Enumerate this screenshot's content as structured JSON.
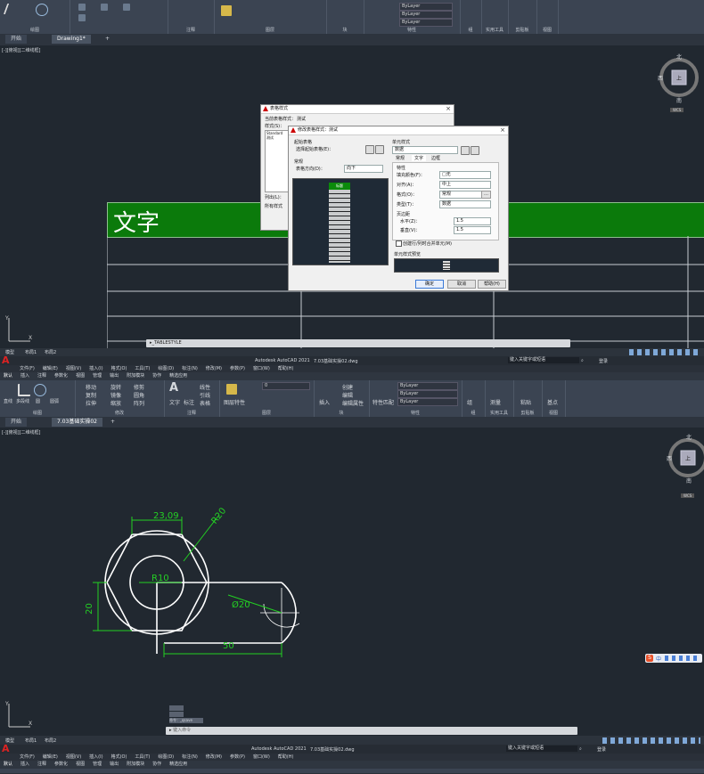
{
  "top": {
    "ribbon_groups": [
      "绘图",
      "注释",
      "图层",
      "块",
      "特性",
      "组",
      "实用工具",
      "剪贴板",
      "视图"
    ],
    "layer_value": "ByLayer",
    "tabs": [
      {
        "label": "开始"
      },
      {
        "label": "Drawing1*"
      }
    ],
    "tab_add": "+",
    "viewport_label": "[-][俯视][二维线框]",
    "viewcube": {
      "n": "北",
      "s": "南",
      "w": "西",
      "top": "上",
      "wcs": "WCS"
    },
    "banner_text": "文字",
    "command_text": "TABLESTYLE",
    "layout_tabs": [
      "模型",
      "布局1",
      "布局2"
    ]
  },
  "dialog_back": {
    "title": "表格样式",
    "current_label": "当前表格样式：",
    "current_value": "测试",
    "styles_label": "样式(S)：",
    "styles": [
      "Standard",
      "测试"
    ],
    "list_label": "列出(L)：",
    "list_value": "所有样式"
  },
  "dialog_front": {
    "title": "修改表格样式：测试",
    "start_table_label": "起始表格",
    "select_start_label": "选择起始表格(E)：",
    "general_label": "常规",
    "direction_label": "表格方向(D)：",
    "direction_value": "向下",
    "preview_header": "标题",
    "cell_style_label": "单元样式",
    "cell_style_value": "数据",
    "tabs": [
      "常规",
      "文字",
      "边框"
    ],
    "props_label": "特性",
    "fill_label": "填充颜色(F)：",
    "fill_value": "□无",
    "align_label": "对齐(A)：",
    "align_value": "中上",
    "format_label": "格式(O)：",
    "format_value": "常规",
    "type_label": "类型(T)：",
    "type_value": "数据",
    "margins_label": "页边距",
    "horiz_label": "水平(Z)：",
    "horiz_value": "1.5",
    "vert_label": "垂直(V)：",
    "vert_value": "1.5",
    "merge_label": "创建行/列时合并单元(M)",
    "preview_label": "单元样式预览",
    "ok": "确定",
    "cancel": "取消",
    "help": "帮助(H)"
  },
  "app": {
    "title": "Autodesk AutoCAD 2021",
    "file_top": "7.03基础实操02.dwg",
    "file_bottom": "7.03基础实操02.dwg",
    "search_placeholder": "键入关键字或短语",
    "login": "登录",
    "menu": [
      "文件(F)",
      "编辑(E)",
      "视图(V)",
      "插入(I)",
      "格式(O)",
      "工具(T)",
      "绘图(D)",
      "标注(N)",
      "修改(M)",
      "参数(P)",
      "窗口(W)",
      "帮助(H)"
    ],
    "ribbon_tabs": [
      "默认",
      "插入",
      "注释",
      "参数化",
      "视图",
      "管理",
      "输出",
      "附加模块",
      "协作",
      "精选应用"
    ]
  },
  "bottom": {
    "ribbon_groups": [
      "绘图",
      "修改",
      "注释",
      "图层",
      "块",
      "特性",
      "组",
      "实用工具",
      "剪贴板",
      "视图"
    ],
    "tools": {
      "line": "直线",
      "polyline": "多段线",
      "circle": "圆",
      "arc": "圆弧",
      "move": "移动",
      "rotate": "旋转",
      "trim": "修剪",
      "copy": "复制",
      "mirror": "镜像",
      "fillet": "圆角",
      "stretch": "拉伸",
      "scale": "缩放",
      "array": "阵列",
      "text": "文字",
      "dimension": "标注",
      "linear": "线性",
      "leader": "引线",
      "table": "表格",
      "layer_props": "图层特性",
      "layer_value": "0",
      "insert": "插入",
      "create": "创建",
      "edit": "编辑",
      "edit_attr": "编辑属性",
      "match": "特性匹配",
      "bylayer": "ByLayer",
      "group": "组",
      "measure": "测量",
      "paste": "粘贴",
      "base": "基点"
    },
    "tabs": [
      {
        "label": "开始"
      },
      {
        "label": "7.03基础实操02"
      }
    ],
    "tab_add": "+",
    "viewport_label": "[-][俯视][二维线框]",
    "viewcube": {
      "n": "北",
      "s": "南",
      "w": "西",
      "top": "上",
      "wcs": "WCS"
    },
    "dims": {
      "top": "23,09",
      "r_outer": "R20",
      "r_inner": "R10",
      "phi": "Ø20",
      "left": "20",
      "bottom": "50"
    },
    "cmd_history": [
      "",
      "",
      "命令：_qsave"
    ],
    "command_placeholder": "键入命令",
    "layout_tabs": [
      "模型",
      "布局1",
      "布局2"
    ],
    "ime_label": "中"
  }
}
